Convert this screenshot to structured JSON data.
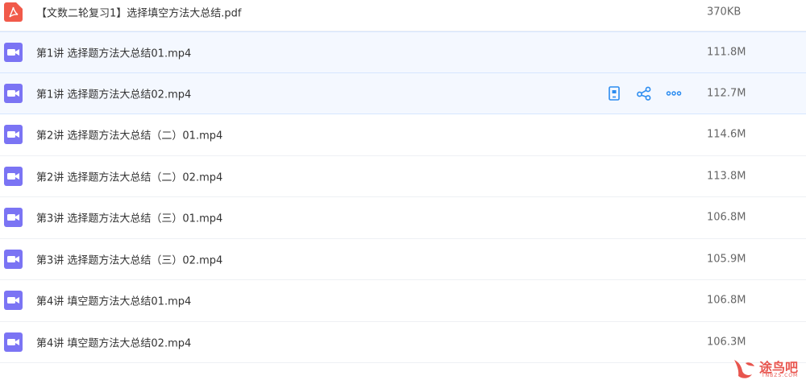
{
  "colors": {
    "pdf_icon": "#f15a4a",
    "video_icon": "#7b74f4",
    "action_icon": "#2b8cf0",
    "watermark": "#e8554e"
  },
  "files": [
    {
      "name": "【文数二轮复习1】选择填空方法大总结.pdf",
      "size": "370KB",
      "icon": "pdf-icon"
    },
    {
      "name": "第1讲 选择题方法大总结01.mp4",
      "size": "111.8M",
      "icon": "video-icon"
    },
    {
      "name": "第1讲 选择题方法大总结02.mp4",
      "size": "112.7M",
      "icon": "video-icon"
    },
    {
      "name": "第2讲 选择题方法大总结（二）01.mp4",
      "size": "114.6M",
      "icon": "video-icon"
    },
    {
      "name": "第2讲 选择题方法大总结（二）02.mp4",
      "size": "113.8M",
      "icon": "video-icon"
    },
    {
      "name": "第3讲 选择题方法大总结（三）01.mp4",
      "size": "106.8M",
      "icon": "video-icon"
    },
    {
      "name": "第3讲 选择题方法大总结（三）02.mp4",
      "size": "105.9M",
      "icon": "video-icon"
    },
    {
      "name": "第4讲 填空题方法大总结01.mp4",
      "size": "106.8M",
      "icon": "video-icon"
    },
    {
      "name": "第4讲 填空题方法大总结02.mp4",
      "size": "106.3M",
      "icon": "video-icon"
    }
  ],
  "row_actions": [
    "mobile-icon",
    "share-icon",
    "more-icon"
  ],
  "watermark": {
    "text": "途鸟吧",
    "sub": "TNBZS.COM"
  }
}
